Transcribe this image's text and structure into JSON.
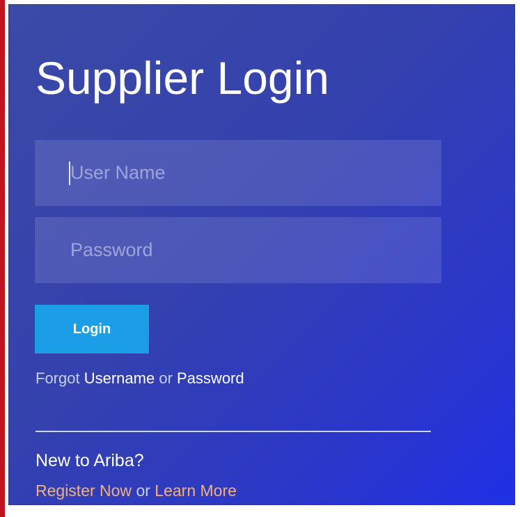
{
  "login": {
    "title": "Supplier Login",
    "username_placeholder": "User Name",
    "password_placeholder": "Password",
    "login_button": "Login",
    "forgot_prefix": "Forgot",
    "forgot_username": "Username",
    "forgot_or": "or",
    "forgot_password": "Password"
  },
  "new_user": {
    "heading": "New to Ariba?",
    "register_now": "Register Now",
    "or": "or",
    "learn_more": "Learn More"
  },
  "colors": {
    "panel_gradient_start": "#3b4aa6",
    "panel_gradient_end": "#1f30e6",
    "login_button": "#1c9ee6",
    "link_accent": "#f3b07a",
    "frame_edge": "#c0141c"
  }
}
